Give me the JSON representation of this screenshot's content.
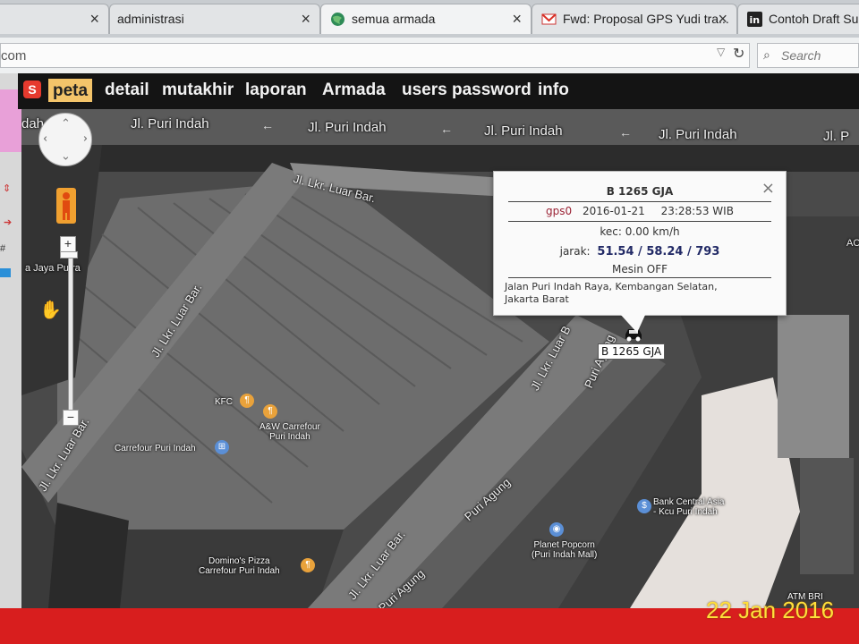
{
  "browser": {
    "tabs": [
      {
        "label": "administrasi"
      },
      {
        "label": "semua armada"
      },
      {
        "label": "Fwd: Proposal GPS Yudi tra..."
      },
      {
        "label": "Contoh Draft Sura"
      }
    ],
    "close_glyph": "×",
    "url_text": "com",
    "search_placeholder": "Search"
  },
  "nav": {
    "items": [
      "peta",
      "detail",
      "mutakhir",
      "laporan",
      "Armada",
      "users",
      "password",
      "info"
    ],
    "active": "peta"
  },
  "map": {
    "street_labels": {
      "puri_indah_1": "Jl. Puri Indah",
      "puri_indah_2": "Jl. Puri Indah",
      "puri_indah_3": "Jl. Puri Indah",
      "puri_indah_4": "Jl. Puri Indah",
      "puri_indah_5": "Jl. P",
      "lkr_luar_bar_top": "Jl. Lkr. Luar Bar.",
      "lkr_luar_bar_left": "Jl. Lkr. Luar Bar.",
      "lkr_luar_bar_bottom_left": "Jl. Lkr. Luar Bar.",
      "lkr_luar_bar_center": "Jl. Lkr. Luar Bar.",
      "lkr_luar_bar_right": "Jl. Lkr. Luar B",
      "puri_agung_1": "Puri Agung",
      "puri_agung_2": "Puri Agung",
      "puri_agung_3": "Puri Agung",
      "dah": "dah",
      "jaya_putra": "a Jaya Putra",
      "ac": "AC"
    },
    "pois": {
      "kfc": "KFC",
      "aw_carrefour": "A&W Carrefour\nPuri Indah",
      "carrefour": "Carrefour Puri Indah",
      "dominos": "Domino's Pizza\nCarrefour Puri Indah",
      "bca": "Bank Central Asia\n- Kcu Puri Indah",
      "planet_popcorn": "Planet Popcorn\n(Puri Indah Mall)",
      "atm_bri": "ATM BRI"
    },
    "zoom_in": "+",
    "zoom_out": "−"
  },
  "popup": {
    "plate": "B 1265 GJA",
    "device": "gps0",
    "date": "2016-01-21",
    "time": "23:28:53 WIB",
    "speed": "kec: 0.00 km/h",
    "distance_label": "jarak:",
    "distance_value": "51.54 / 58.24 / 793",
    "engine": "Mesin OFF",
    "address_line1": "Jalan Puri Indah Raya, Kembangan Selatan,",
    "address_line2": "Jakarta Barat",
    "close": "×"
  },
  "vehicle_label": "B 1265 GJA",
  "photo_date_stamp": "22 Jan 2016",
  "colors": {
    "nav_bg": "#141414",
    "nav_active_bg": "#f3c46a",
    "popup_device": "#9b2335",
    "popup_distance": "#222a66",
    "stamp": "#ffdf3b",
    "bottom_bar": "#d81e1e"
  }
}
